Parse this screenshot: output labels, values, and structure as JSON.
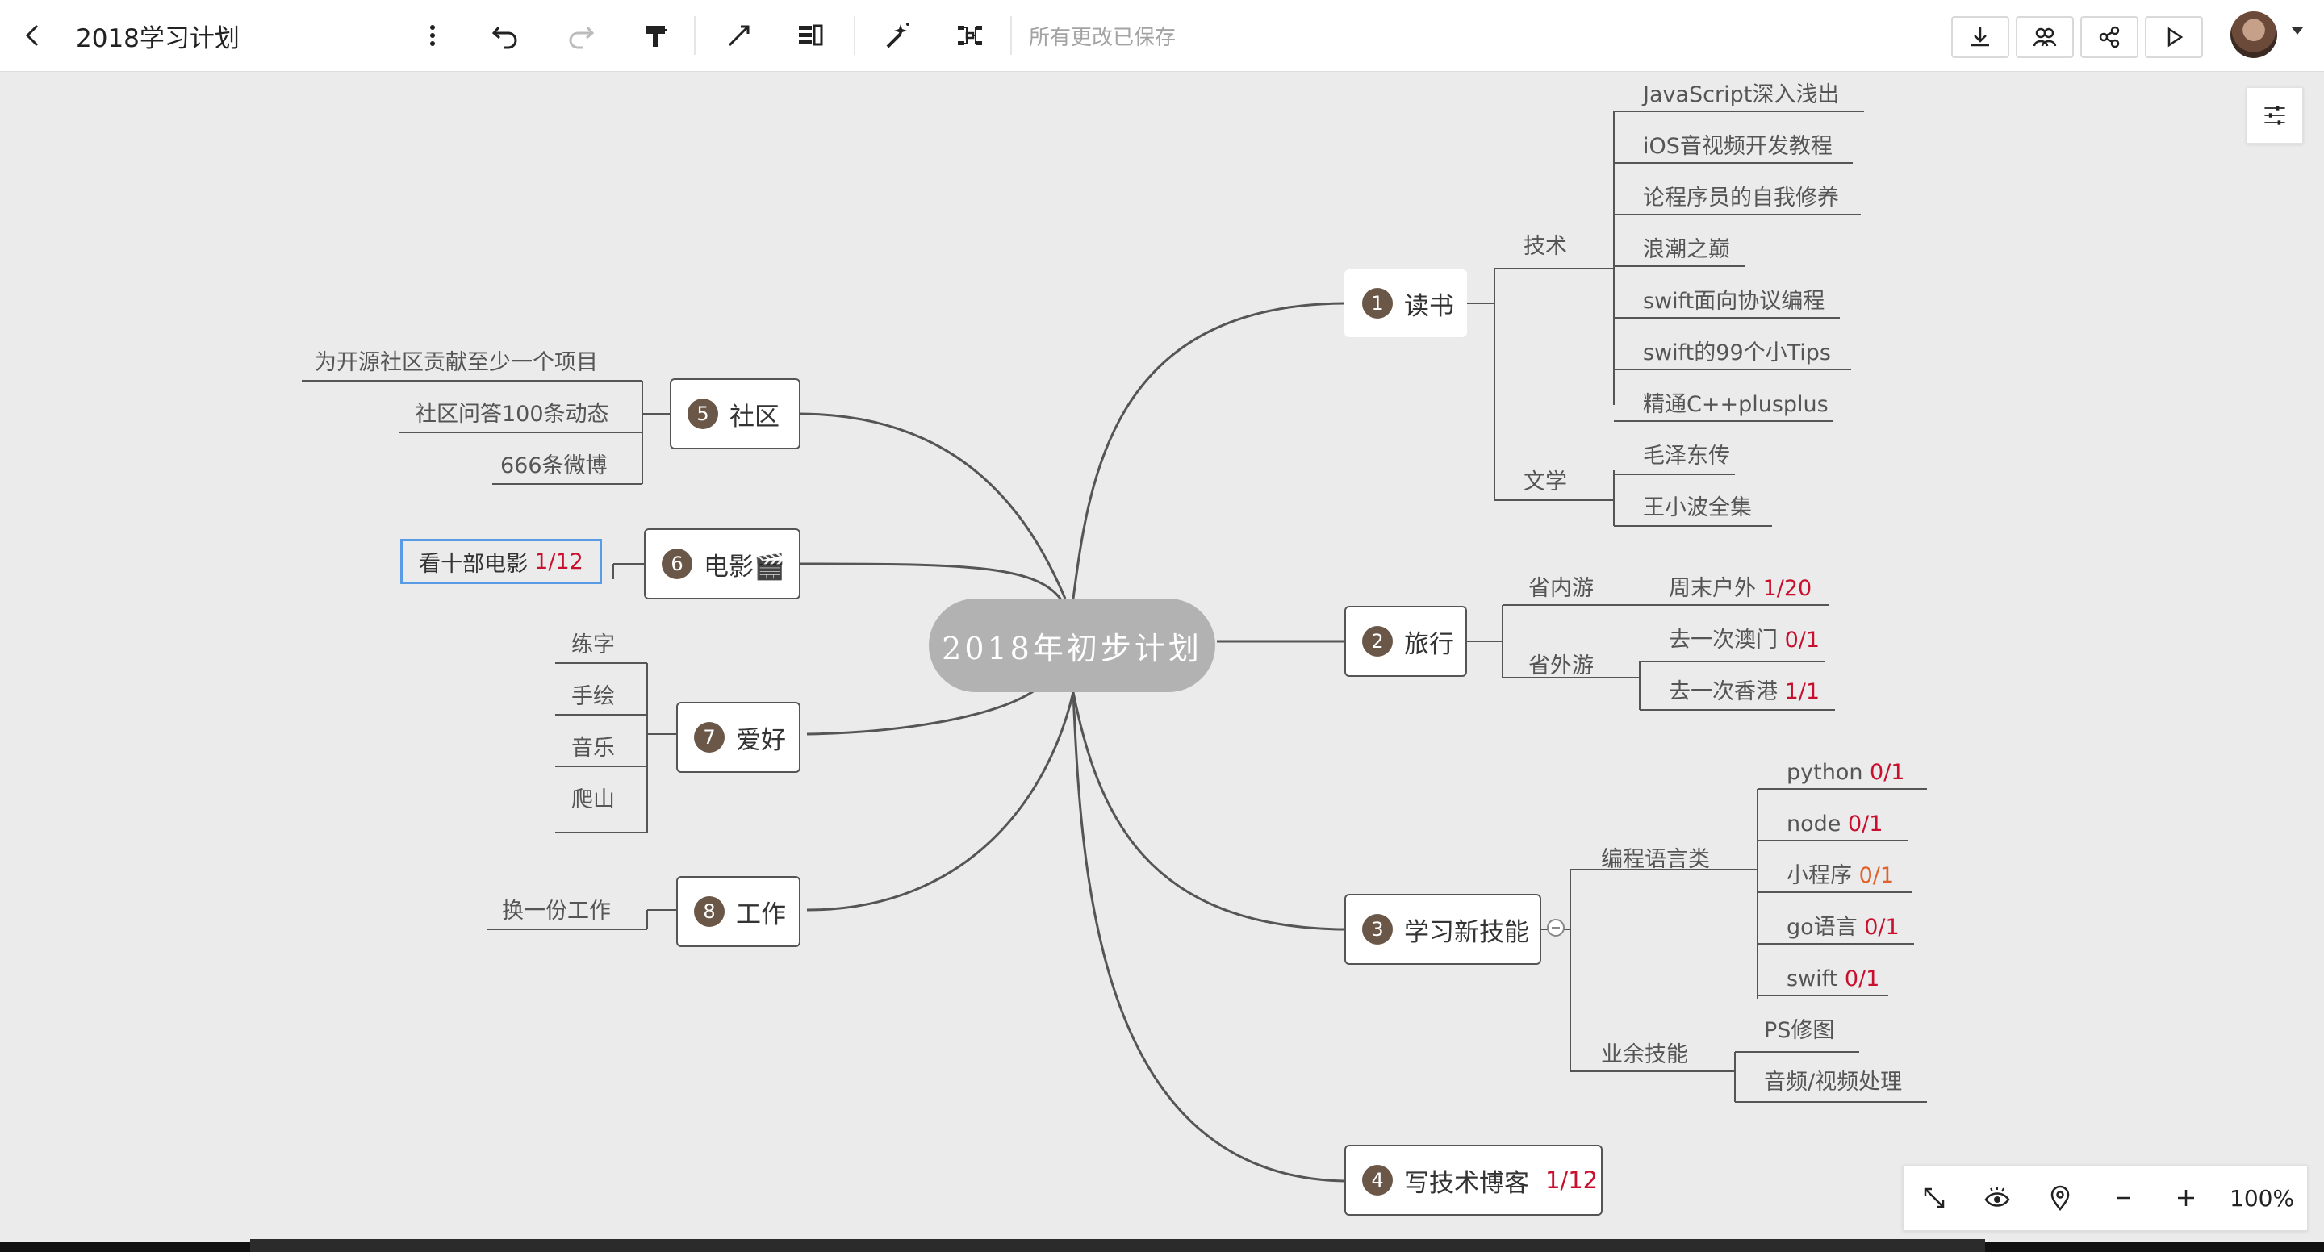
{
  "toolbar": {
    "back_icon": "chevron-left-icon",
    "title": "2018学习计划",
    "save_status": "所有更改已保存",
    "icons": [
      "more-vertical-icon",
      "undo-icon",
      "redo-icon",
      "format-painter-icon",
      "connector-icon",
      "outline-icon",
      "magic-wand-icon",
      "structure-icon"
    ],
    "right_icons": [
      "download-icon",
      "collaborate-icon",
      "share-icon",
      "present-icon"
    ]
  },
  "map": {
    "root": "2018年初步计划",
    "topics": [
      {
        "num": "1",
        "label": "读书",
        "progress": ""
      },
      {
        "num": "2",
        "label": "旅行",
        "progress": ""
      },
      {
        "num": "3",
        "label": "学习新技能",
        "progress": ""
      },
      {
        "num": "4",
        "label": "写技术博客",
        "progress": "1/12"
      },
      {
        "num": "5",
        "label": "社区",
        "progress": ""
      },
      {
        "num": "6",
        "label": "电影🎬",
        "progress": ""
      },
      {
        "num": "7",
        "label": "爱好",
        "progress": ""
      },
      {
        "num": "8",
        "label": "工作",
        "progress": ""
      }
    ],
    "reading": {
      "tech_label": "技术",
      "tech_books": [
        "JavaScript深入浅出",
        "iOS音视频开发教程",
        "论程序员的自我修养",
        "浪潮之巅",
        "swift面向协议编程",
        "swift的99个小Tips",
        "精通C++plusplus"
      ],
      "lit_label": "文学",
      "lit_books": [
        "毛泽东传",
        "王小波全集"
      ]
    },
    "travel": {
      "in_label": "省内游",
      "in_items": [
        {
          "text": "周末户外",
          "progress": "1/20"
        }
      ],
      "out_label": "省外游",
      "out_items": [
        {
          "text": "去一次澳门",
          "progress": "0/1"
        },
        {
          "text": "去一次香港",
          "progress": "1/1"
        }
      ]
    },
    "skills": {
      "lang_label": "编程语言类",
      "langs": [
        {
          "text": "python ",
          "progress": "0/1"
        },
        {
          "text": "node ",
          "progress": "0/1"
        },
        {
          "text": "小程序 ",
          "progress": "0/1"
        },
        {
          "text": "go语言 ",
          "progress": "0/1"
        },
        {
          "text": "swift ",
          "progress": "0/1"
        }
      ],
      "spare_label": "业余技能",
      "spare": [
        "PS修图",
        "音频/视频处理"
      ]
    },
    "community": [
      "为开源社区贡献至少一个项目",
      "社区问答100条动态",
      "666条微博"
    ],
    "movie": {
      "text": "看十部电影",
      "progress": "1/12"
    },
    "hobbies": [
      "练字",
      "手绘",
      "音乐",
      "爬山"
    ],
    "work": [
      "换一份工作"
    ]
  },
  "zoom": {
    "icons": [
      "fit-icon",
      "eye-icon",
      "locate-icon",
      "zoom-out-icon",
      "zoom-in-icon"
    ],
    "level": "100%"
  }
}
